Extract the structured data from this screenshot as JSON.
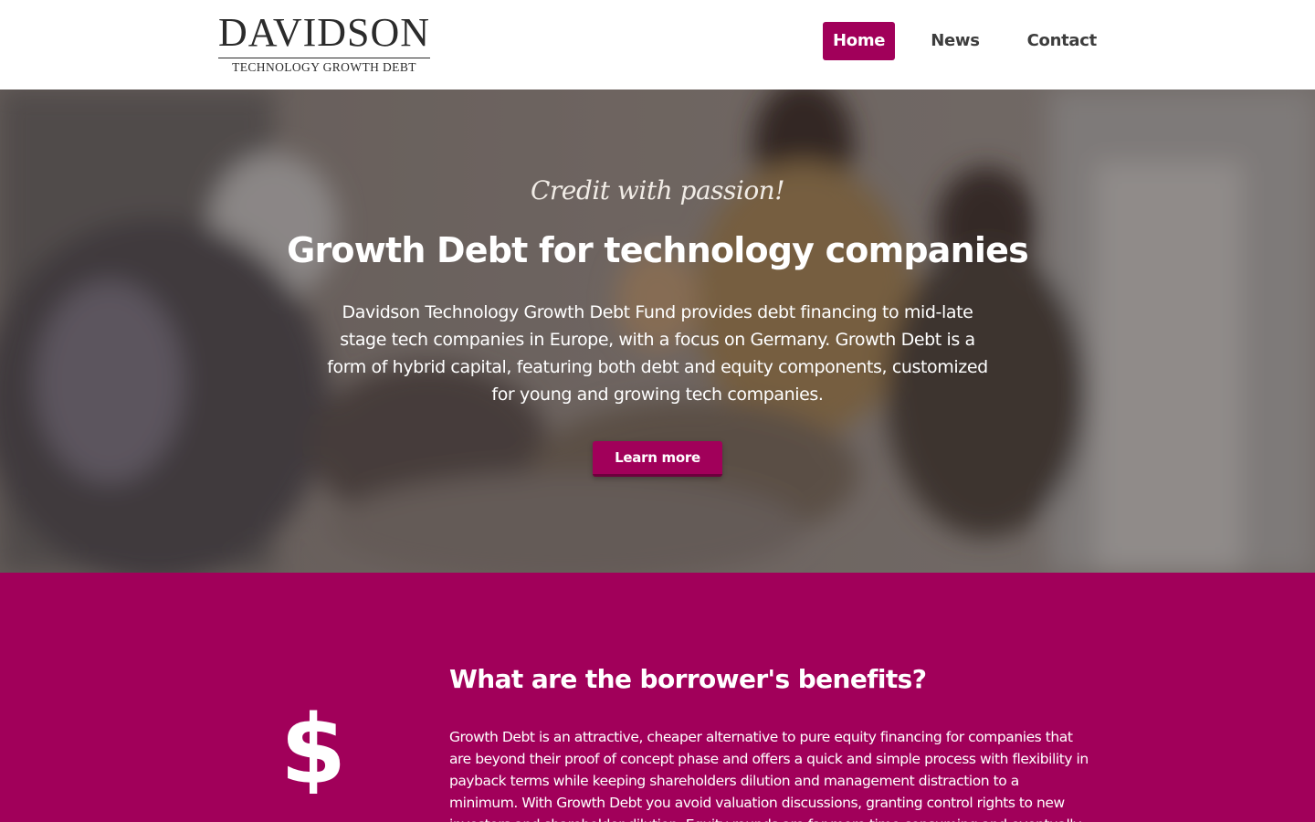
{
  "brand": {
    "name": "DAVIDSON",
    "subtitle": "TECHNOLOGY GROWTH DEBT"
  },
  "nav": {
    "items": [
      {
        "label": "Home",
        "active": true
      },
      {
        "label": "News",
        "active": false
      },
      {
        "label": "Contact",
        "active": false
      }
    ]
  },
  "hero": {
    "tagline": "Credit with passion!",
    "title": "Growth Debt for technology companies",
    "text": "Davidson Technology Growth Debt Fund provides debt financing to mid-late stage tech companies in Europe, with a focus on Germany. Growth Debt is a form of hybrid capital, featuring both debt and equity components, customized for young and growing tech companies.",
    "button_label": "Learn more"
  },
  "benefits": {
    "icon": "dollar-icon",
    "title": "What are the borrower's benefits?",
    "text": "Growth Debt is an attractive, cheaper alternative to pure equity financing for companies that are beyond their proof of concept phase and offers a quick and simple process with flexibility in payback terms while keeping shareholders dilution and management distraction to a minimum. With Growth Debt you avoid valuation discussions, granting control rights to new investors and shareholder dilution. Equity rounds are far more time consuming and eventually more expensive"
  },
  "colors": {
    "accent": "#a1005a",
    "accent_dark": "#6e003d",
    "text_dark": "#3d3d3d"
  }
}
